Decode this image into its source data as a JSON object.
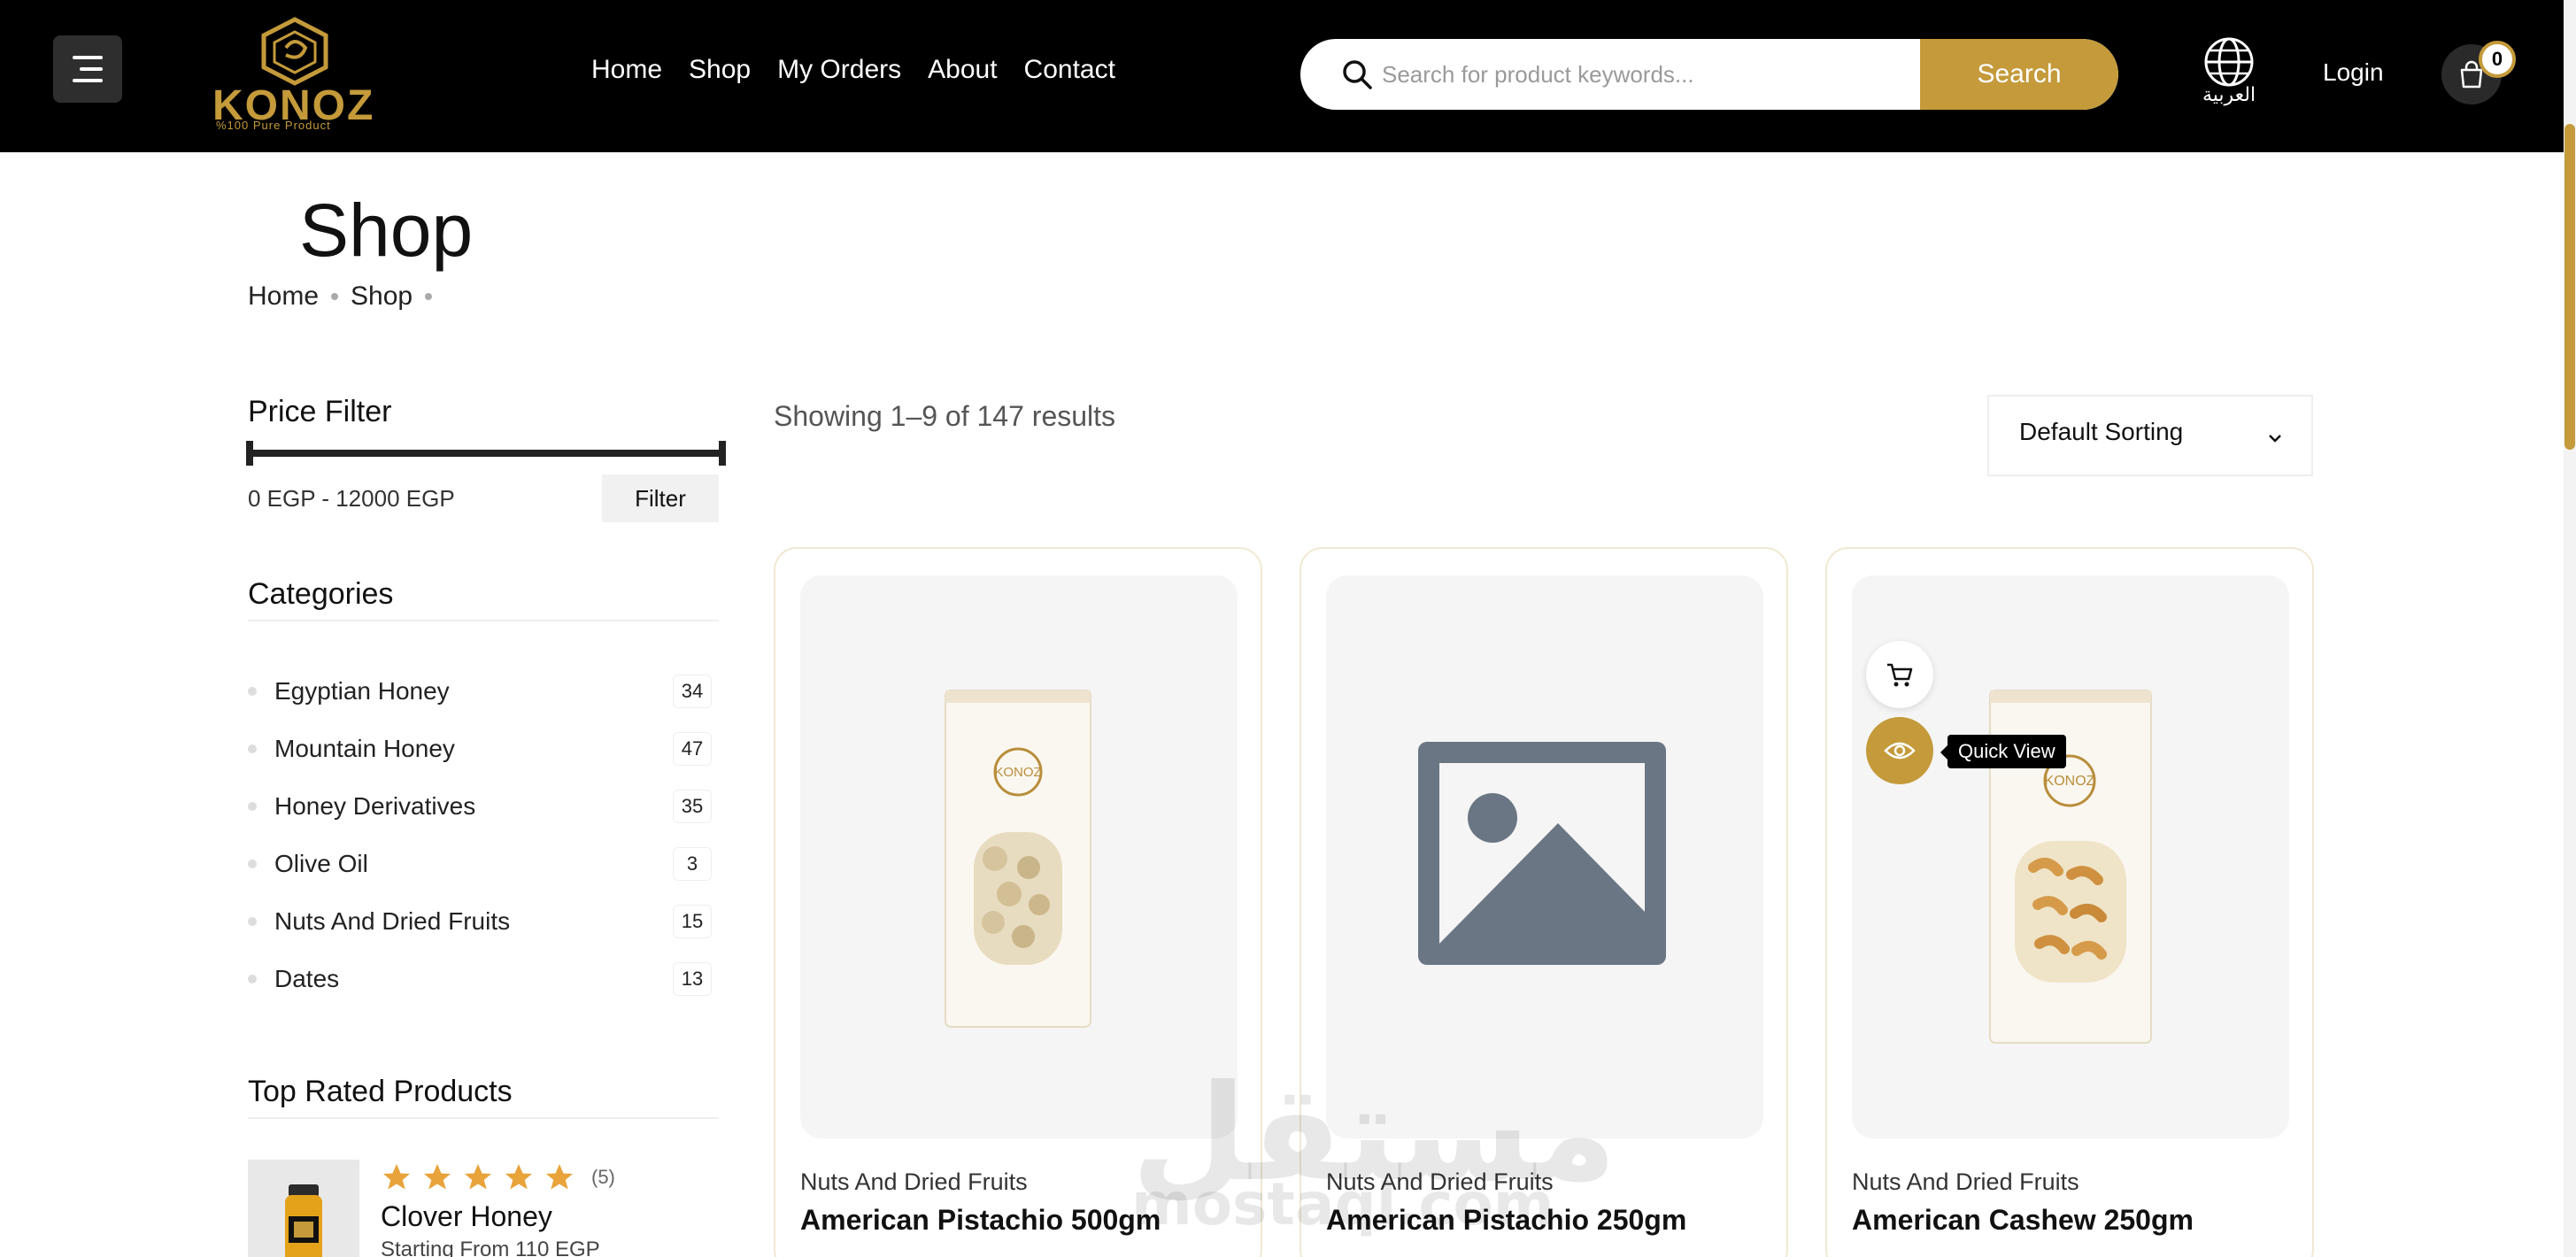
{
  "header": {
    "logo_text": "KONOZ",
    "logo_subtext": "%100 Pure Product",
    "nav": [
      "Home",
      "Shop",
      "My Orders",
      "About",
      "Contact"
    ],
    "search_placeholder": "Search for product keywords...",
    "search_button": "Search",
    "language_label": "العربية",
    "login": "Login",
    "cart_count": "0"
  },
  "page": {
    "title": "Shop",
    "breadcrumb": [
      "Home",
      "Shop"
    ]
  },
  "sidebar": {
    "price_filter": {
      "heading": "Price Filter",
      "range": "0 EGP - 12000 EGP",
      "button": "Filter"
    },
    "categories": {
      "heading": "Categories",
      "items": [
        {
          "name": "Egyptian Honey",
          "count": "34"
        },
        {
          "name": "Mountain Honey",
          "count": "47"
        },
        {
          "name": "Honey Derivatives",
          "count": "35"
        },
        {
          "name": "Olive Oil",
          "count": "3"
        },
        {
          "name": "Nuts And Dried Fruits",
          "count": "15"
        },
        {
          "name": "Dates",
          "count": "13"
        }
      ]
    },
    "top_rated": {
      "heading": "Top Rated Products",
      "items": [
        {
          "name": "Clover Honey",
          "rating": 5,
          "rating_count": "(5)",
          "price": "Starting From 110 EGP"
        }
      ]
    }
  },
  "results": {
    "summary": "Showing 1–9 of 147 results",
    "sort_selected": "Default Sorting"
  },
  "products": [
    {
      "category": "Nuts And Dried Fruits",
      "title": "American Pistachio 500gm",
      "image": "pistachio-bag"
    },
    {
      "category": "Nuts And Dried Fruits",
      "title": "American Pistachio 250gm",
      "image": "placeholder-image"
    },
    {
      "category": "Nuts And Dried Fruits",
      "title": "American Cashew 250gm",
      "image": "cashew-bag"
    }
  ],
  "quick_view_tooltip": "Quick View",
  "watermark": {
    "text": "مستقل",
    "sub": "mostaql.com"
  },
  "colors": {
    "accent": "#c49a3a",
    "header_bg": "#000000",
    "placeholder_gray": "#6b7684"
  }
}
